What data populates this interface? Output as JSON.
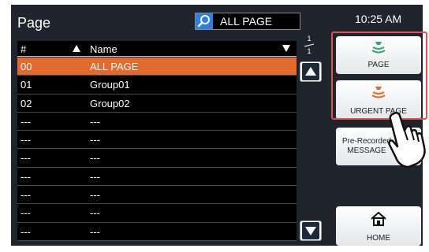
{
  "header": {
    "title": "Page",
    "search_value": "ALL PAGE",
    "clock": "10:25 AM"
  },
  "list": {
    "columns": {
      "number": "#",
      "name": "Name"
    },
    "rows": [
      {
        "number": "00",
        "name": "ALL PAGE",
        "selected": true
      },
      {
        "number": "01",
        "name": "Group01"
      },
      {
        "number": "02",
        "name": "Group02"
      },
      {
        "number": "---",
        "name": "---"
      },
      {
        "number": "---",
        "name": "---"
      },
      {
        "number": "---",
        "name": "---"
      },
      {
        "number": "---",
        "name": "---"
      },
      {
        "number": "---",
        "name": "---"
      },
      {
        "number": "---",
        "name": "---"
      },
      {
        "number": "---",
        "name": "---"
      }
    ],
    "page_current": "1",
    "page_total": "1"
  },
  "sidebar": {
    "page_label": "PAGE",
    "urgent_label": "URGENT PAGE",
    "message_label": "Pre-Recorded MESSAGE",
    "home_label": "HOME"
  },
  "colors": {
    "background": "#20242c",
    "selected_row": "#e36a2e",
    "page_icon": "#2fa86c",
    "urgent_icon": "#e36a2e",
    "highlight_frame": "#d9534f"
  },
  "icons": {
    "search": "search-icon",
    "page": "page-speaker-icon",
    "urgent": "urgent-speaker-icon",
    "home": "home-icon",
    "pointer": "pointing-hand-icon"
  }
}
